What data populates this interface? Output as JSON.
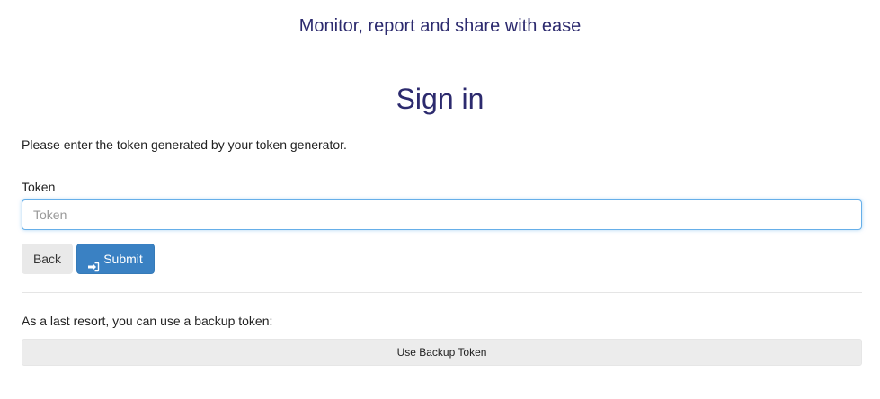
{
  "header": {
    "tagline": "Monitor, report and share with ease",
    "title": "Sign in"
  },
  "form": {
    "instructions": "Please enter the token generated by your token generator.",
    "token_label": "Token",
    "token_placeholder": "Token",
    "token_value": "",
    "back_label": "Back",
    "submit_label": "Submit",
    "submit_icon": "sign-in-icon"
  },
  "backup": {
    "text": "As a last resort, you can use a backup token:",
    "button_label": "Use Backup Token"
  },
  "colors": {
    "heading": "#2c2a6e",
    "primary": "#3a81c3",
    "input_focus_border": "#66afe9"
  }
}
